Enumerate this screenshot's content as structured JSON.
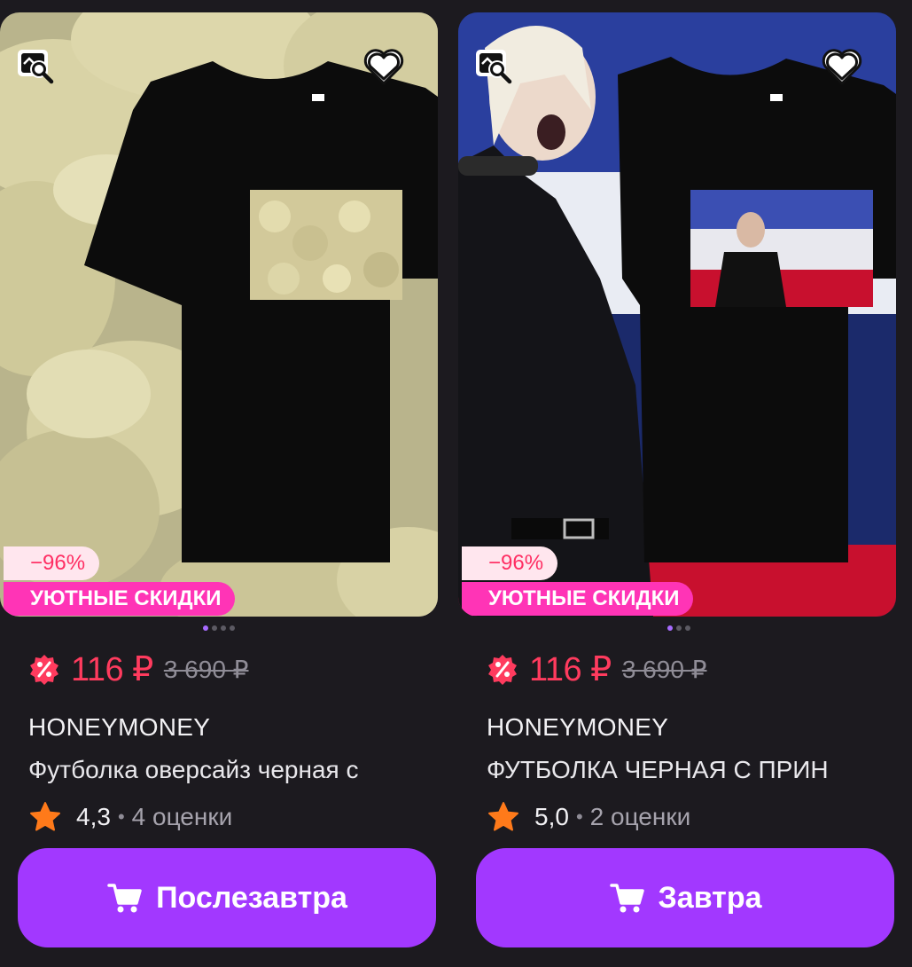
{
  "colors": {
    "background": "#1c1a1f",
    "accent": "#a238ff",
    "price": "#ff3b5e",
    "promo": "#ff34b6",
    "discount_bg": "#ffe6ee"
  },
  "products": [
    {
      "image_subject": "black t-shirt with dumplings print over dumplings photo",
      "discount": "−96%",
      "promo": "УЮТНЫЕ СКИДКИ",
      "price": "116 ₽",
      "old_price": "3 690 ₽",
      "brand": "HONEYMONEY",
      "title": "Футболка оверсайз черная с",
      "rating": "4,3",
      "separator": "•",
      "reviews": "4 оценки",
      "button": "Послезавтра",
      "gallery_dots": 4,
      "gallery_active": 0
    },
    {
      "image_subject": "black t-shirt with singer print over concert photo",
      "discount": "−96%",
      "promo": "УЮТНЫЕ СКИДКИ",
      "price": "116 ₽",
      "old_price": "3 690 ₽",
      "brand": "HONEYMONEY",
      "title": "ФУТБОЛКА ЧЕРНАЯ С ПРИН",
      "rating": "5,0",
      "separator": "•",
      "reviews": "2 оценки",
      "button": "Завтра",
      "gallery_dots": 3,
      "gallery_active": 0
    }
  ],
  "icons": {
    "search": "image-search-icon",
    "favorite": "heart-icon",
    "discount_badge": "percent-badge-icon",
    "rating": "star-icon",
    "cart": "cart-icon"
  }
}
